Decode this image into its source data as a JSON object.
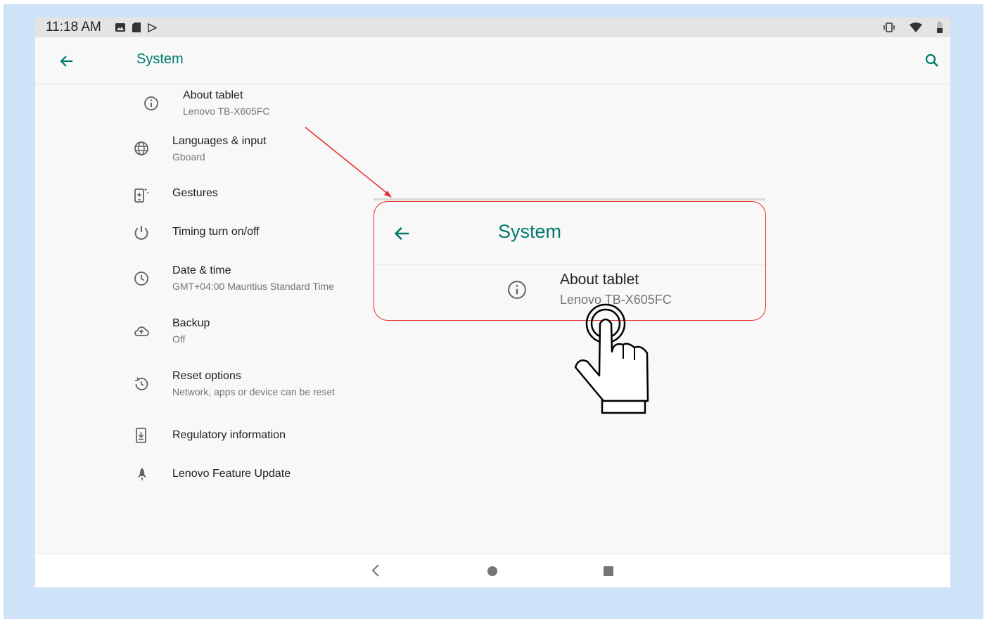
{
  "status_bar": {
    "time": "11:18 AM"
  },
  "app_bar": {
    "title": "System"
  },
  "settings_items": [
    {
      "title": "About tablet",
      "subtitle": "Lenovo TB-X605FC"
    },
    {
      "title": "Languages & input",
      "subtitle": "Gboard"
    },
    {
      "title": "Gestures",
      "subtitle": ""
    },
    {
      "title": "Timing turn on/off",
      "subtitle": ""
    },
    {
      "title": "Date & time",
      "subtitle": "GMT+04:00 Mauritius Standard Time"
    },
    {
      "title": "Backup",
      "subtitle": "Off"
    },
    {
      "title": "Reset options",
      "subtitle": "Network, apps or device can be reset"
    },
    {
      "title": "Regulatory information",
      "subtitle": ""
    },
    {
      "title": "Lenovo Feature Update",
      "subtitle": ""
    }
  ],
  "zoom_callout": {
    "title": "System",
    "item_title": "About tablet",
    "item_subtitle": "Lenovo TB-X605FC"
  },
  "colors": {
    "accent": "#00796b",
    "highlight": "#e52f2f",
    "background_frame": "#cfe3f8"
  },
  "icons": {
    "back": "arrow-left-icon",
    "search": "search-icon",
    "about": "info-icon",
    "languages": "globe-icon",
    "gestures": "gesture-phone-icon",
    "timing": "power-icon",
    "date": "clock-icon",
    "backup": "cloud-upload-icon",
    "reset": "history-icon",
    "regulatory": "document-download-icon",
    "update": "rocket-icon"
  }
}
